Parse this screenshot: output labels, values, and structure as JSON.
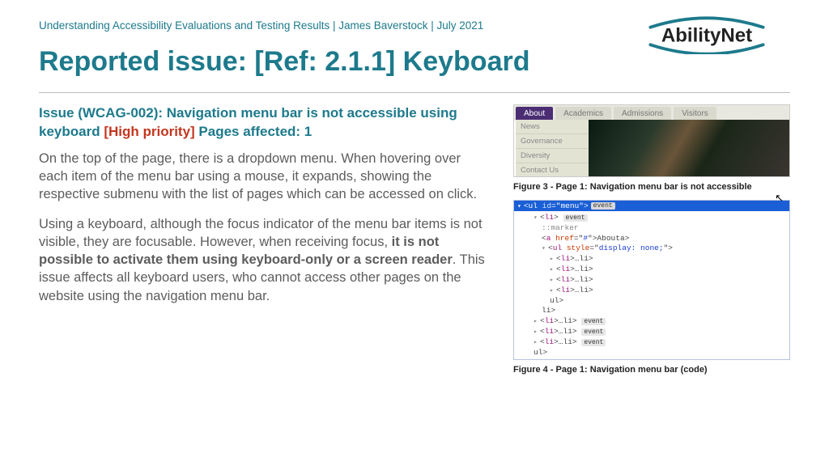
{
  "meta": "Understanding Accessibility Evaluations and Testing Results | James Baverstock | July 2021",
  "logo_text": "AbilityNet",
  "title": "Reported issue: [Ref: 2.1.1] Keyboard",
  "issue": {
    "lead": "Issue (WCAG-002): Navigation menu bar is not accessible using keyboard ",
    "priority": "[High priority] ",
    "tail": "Pages affected: 1"
  },
  "p1": "On the top of the page, there is a dropdown menu. When hovering over each item of the menu bar using a mouse, it expands, showing the respective submenu with the list of pages which can be accessed on click.",
  "p2a": "Using a keyboard, although the focus indicator of the menu bar items is not visible, they are focusable. However, when receiving focus, ",
  "p2b": "it is not possible to activate them using keyboard-only or a screen reader",
  "p2c": ". This issue affects all keyboard users, who cannot access other pages on the website using the navigation menu bar.",
  "fig3": {
    "tabs": [
      "About",
      "Academics",
      "Admissions",
      "Visitors"
    ],
    "submenu": [
      "News",
      "Governance",
      "Diversity",
      "Contact Us"
    ],
    "caption": "Figure 3 - Page 1: Navigation menu bar is not accessible"
  },
  "fig4": {
    "caption": "Figure 4 - Page 1: Navigation menu bar (code)",
    "header": {
      "tag": "ul",
      "attr": "id",
      "val": "menu",
      "badge": "event"
    },
    "lines": [
      {
        "ind": 1,
        "tri": "▾",
        "html": "<<span class='tag'>li</span>>",
        "badge": "event"
      },
      {
        "ind": 2,
        "html": "<span class='marker'>::marker</span>"
      },
      {
        "ind": 2,
        "html": "<<span class='tag'>a</span> <span class='attr'>href</span>=\"<span class='val'>#</span>\">About</<span class='tag'>a</span>>"
      },
      {
        "ind": 2,
        "tri": "▾",
        "html": "<<span class='tag'>ul</span> <span class='attr'>style</span>=\"<span class='val'>display: none;</span>\">"
      },
      {
        "ind": 3,
        "tri": "▸",
        "html": "<<span class='tag'>li</span>>…</<span class='tag'>li</span>>"
      },
      {
        "ind": 3,
        "tri": "▸",
        "html": "<<span class='tag'>li</span>>…</<span class='tag'>li</span>>"
      },
      {
        "ind": 3,
        "tri": "▸",
        "html": "<<span class='tag'>li</span>>…</<span class='tag'>li</span>>"
      },
      {
        "ind": 3,
        "tri": "▸",
        "html": "<<span class='tag'>li</span>>…</<span class='tag'>li</span>>"
      },
      {
        "ind": 3,
        "html": "</<span class='tag'>ul</span>>"
      },
      {
        "ind": 2,
        "html": "</<span class='tag'>li</span>>"
      },
      {
        "ind": 1,
        "tri": "▸",
        "html": "<<span class='tag'>li</span>>…</<span class='tag'>li</span>>",
        "badge": "event"
      },
      {
        "ind": 1,
        "tri": "▸",
        "html": "<<span class='tag'>li</span>>…</<span class='tag'>li</span>>",
        "badge": "event"
      },
      {
        "ind": 1,
        "tri": "▸",
        "html": "<<span class='tag'>li</span>>…</<span class='tag'>li</span>>",
        "badge": "event"
      },
      {
        "ind": 1,
        "html": "</<span class='tag'>ul</span>>"
      }
    ]
  }
}
